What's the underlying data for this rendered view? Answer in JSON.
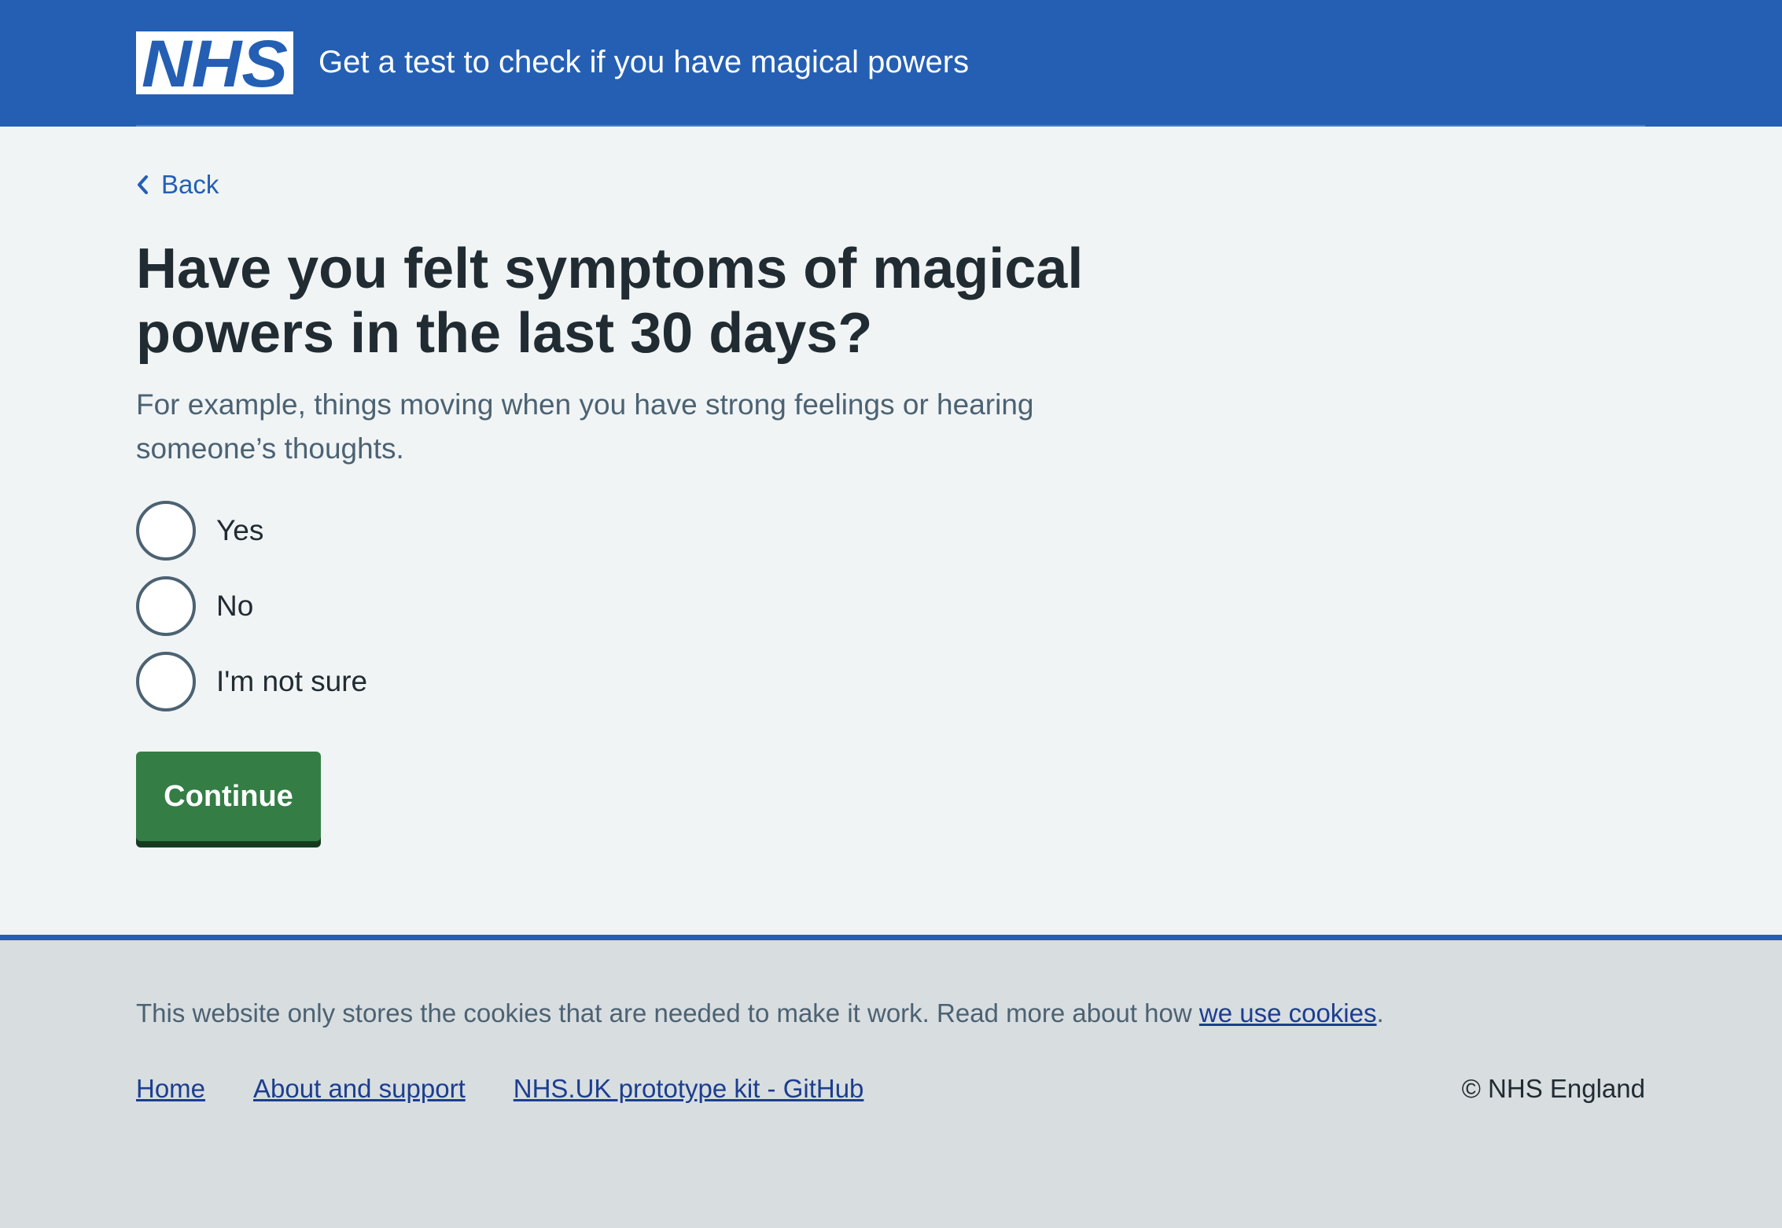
{
  "header": {
    "logo_text": "NHS",
    "service_name": "Get a test to check if you have magical powers",
    "brand_color": "#245fb4"
  },
  "main": {
    "back_label": "Back",
    "heading": "Have you felt symptoms of magical powers in the last 30 days?",
    "hint": "For example, things moving when you have strong feelings or hearing someone’s thoughts.",
    "options": [
      {
        "label": "Yes",
        "selected": false
      },
      {
        "label": "No",
        "selected": false
      },
      {
        "label": "I'm not sure",
        "selected": false
      }
    ],
    "continue_label": "Continue",
    "button_color": "#347d45"
  },
  "footer": {
    "cookie_text_prefix": "This website only stores the cookies that are needed to make it work. Read more about how ",
    "cookie_link": "we use cookies",
    "cookie_text_suffix": ".",
    "links": [
      "Home",
      "About and support",
      "NHS.UK prototype kit - GitHub"
    ],
    "copyright": "© NHS England"
  }
}
